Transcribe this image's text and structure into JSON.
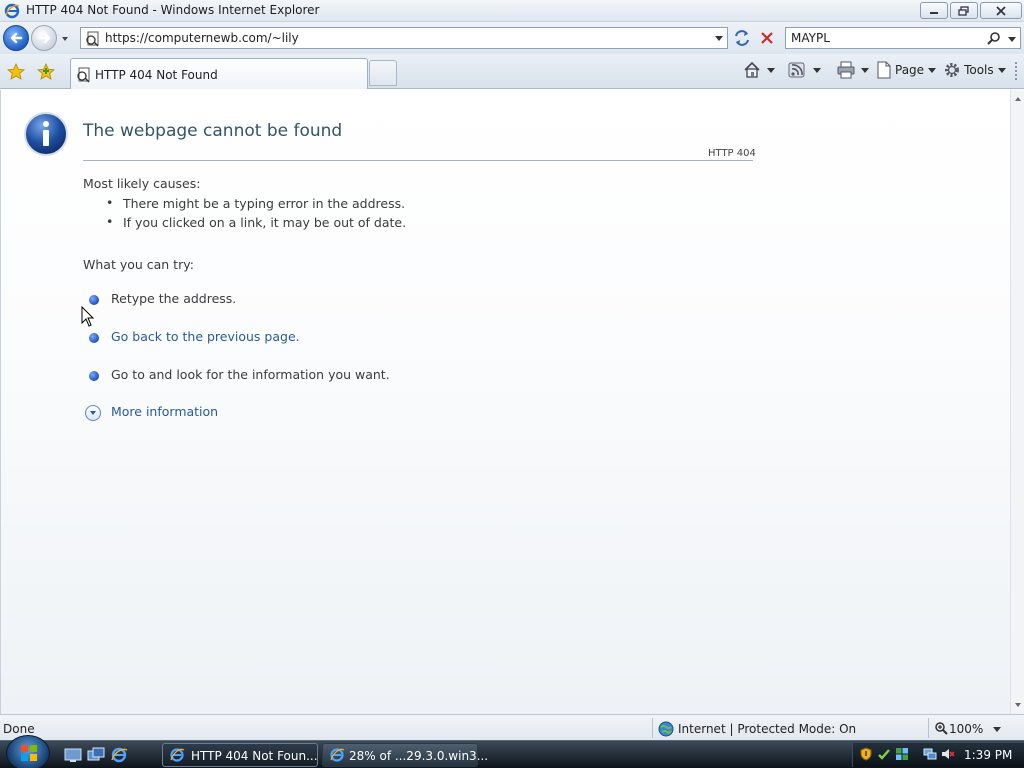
{
  "window": {
    "title": "HTTP 404 Not Found - Windows Internet Explorer",
    "close_label": "X"
  },
  "address_bar": {
    "url": "https://computernewb.com/~lily"
  },
  "search_box": {
    "value": "MAYPL"
  },
  "tab": {
    "label": "HTTP 404 Not Found"
  },
  "command_bar": {
    "page_label": "Page",
    "tools_label": "Tools"
  },
  "page": {
    "heading": "The webpage cannot be found",
    "http_code": "HTTP 404",
    "causes_title": "Most likely causes:",
    "causes": [
      "There might be a typing error in the address.",
      "If you clicked on a link, it may be out of date."
    ],
    "try_title": "What you can try:",
    "try_items": [
      "Retype the address.",
      "Go back to the previous page.",
      "Go to  and look for the information you want."
    ],
    "more_info": "More information"
  },
  "status_bar": {
    "status": "Done",
    "zone": "Internet | Protected Mode: On",
    "zoom": "100%"
  },
  "taskbar": {
    "buttons": [
      "HTTP 404 Not Foun...",
      "28% of ...29.3.0.win3..."
    ],
    "clock": "1:39 PM"
  },
  "colors": {
    "accent_blue": "#1f5fc2",
    "link_color": "#2a5a94",
    "heading_color": "#335566"
  }
}
